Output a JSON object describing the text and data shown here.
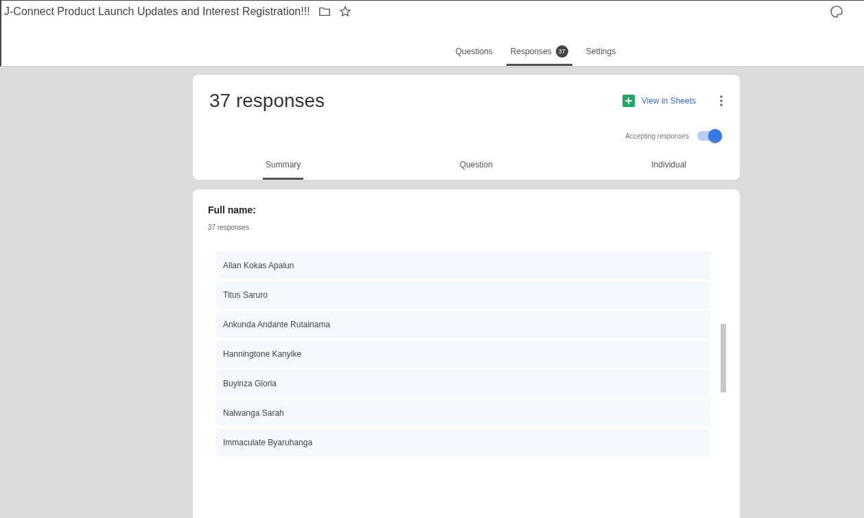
{
  "header": {
    "title": "J-Connect Product Launch Updates and Interest Registration!!!"
  },
  "tabs": [
    {
      "label": "Questions",
      "selected": false
    },
    {
      "label": "Responses",
      "selected": true,
      "badge": "37"
    },
    {
      "label": "Settings",
      "selected": false
    }
  ],
  "summary_card": {
    "title": "37 responses",
    "sheets_link": "View in Sheets",
    "accepting": {
      "label": "Accepting responses",
      "on": true
    },
    "view_tabs": [
      {
        "label": "Summary",
        "selected": true
      },
      {
        "label": "Question",
        "selected": false
      },
      {
        "label": "Individual",
        "selected": false
      }
    ]
  },
  "question": {
    "title": "Full name:",
    "count": "37 responses",
    "answers": [
      "Allan Kokas Apalun",
      "Titus Saruro",
      "Ankunda Andante Rutainama",
      "Hanningtone Kanyike",
      "Buyinza Gloria",
      "Nalwanga Sarah",
      "Immaculate Byaruhanga"
    ]
  }
}
